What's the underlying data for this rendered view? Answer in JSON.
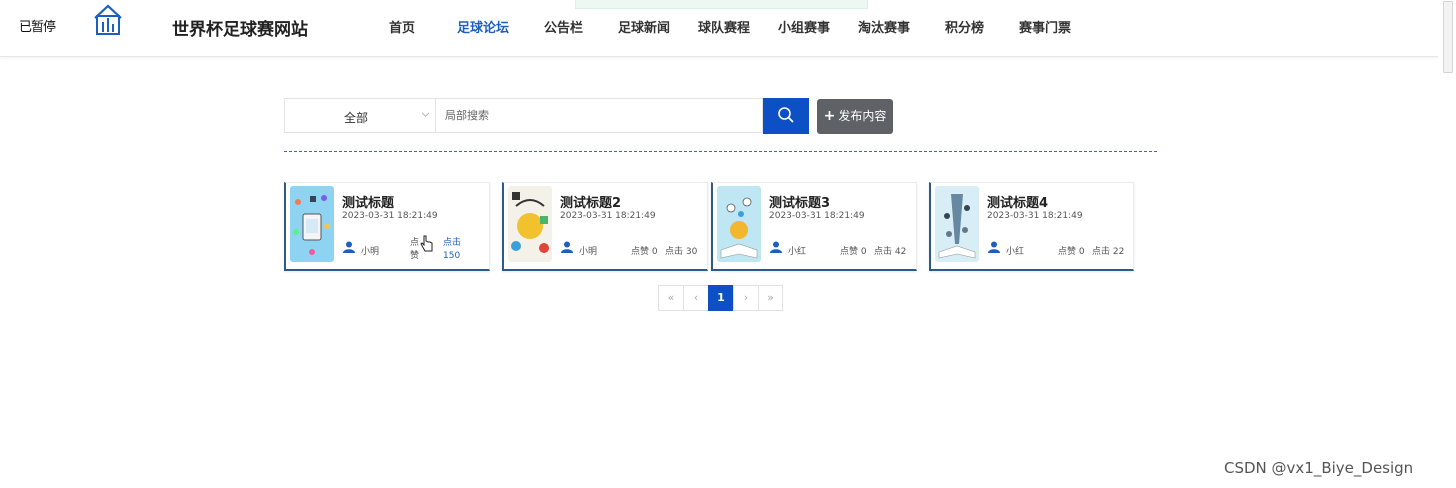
{
  "header": {
    "pause_label": "已暂停",
    "site_title": "世界杯足球赛网站",
    "nav": [
      {
        "label": "首页"
      },
      {
        "label": "足球论坛",
        "active": true
      },
      {
        "label": "公告栏"
      },
      {
        "label": "足球新闻"
      },
      {
        "label": "球队赛程"
      },
      {
        "label": "小组赛事"
      },
      {
        "label": "淘汰赛事"
      },
      {
        "label": "积分榜"
      },
      {
        "label": "赛事门票"
      }
    ]
  },
  "filter": {
    "category_value": "全部",
    "search_placeholder": "局部搜索",
    "search_value": "",
    "publish_label": "发布内容",
    "publish_plus": "+"
  },
  "posts": [
    {
      "title": "测试标题",
      "date": "2023-03-31 18:21:49",
      "author": "小明",
      "likes": "点赞",
      "clicks": "点击 150"
    },
    {
      "title": "测试标题2",
      "date": "2023-03-31 18:21:49",
      "author": "小明",
      "likes": "点赞 0",
      "clicks": "点击 30"
    },
    {
      "title": "测试标题3",
      "date": "2023-03-31 18:21:49",
      "author": "小红",
      "likes": "点赞 0",
      "clicks": "点击 42"
    },
    {
      "title": "测试标题4",
      "date": "2023-03-31 18:21:49",
      "author": "小红",
      "likes": "点赞 0",
      "clicks": "点击 22"
    }
  ],
  "pagination": {
    "first": "«",
    "prev": "‹",
    "current": "1",
    "next": "›",
    "last": "»"
  },
  "watermark": "CSDN @vx1_Biye_Design",
  "colors": {
    "accent": "#0d4fc4",
    "nav_active": "#1d5fbf",
    "card_border": "#2c5a8a",
    "publish_bg": "#5e6266"
  },
  "icons": {
    "logo": "home-chart-icon",
    "search": "search-icon",
    "user": "user-icon",
    "dropdown": "chevron-down-icon"
  }
}
